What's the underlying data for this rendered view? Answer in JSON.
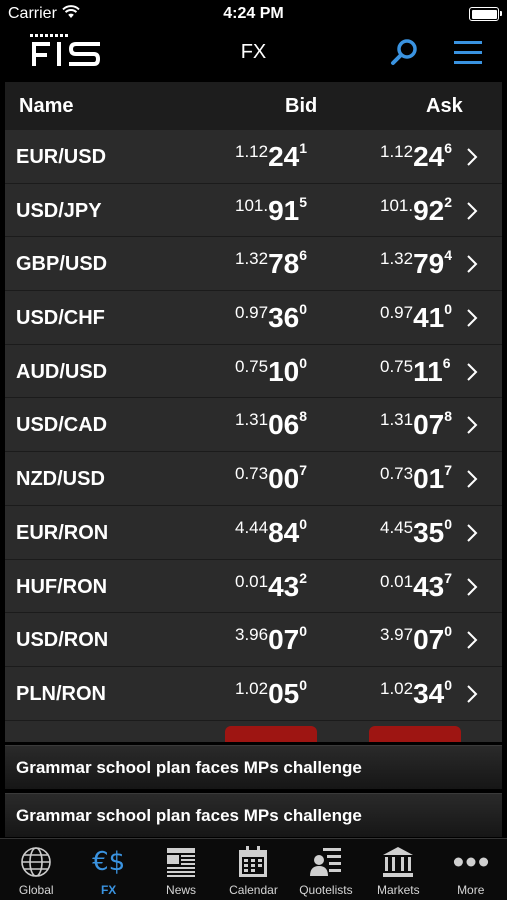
{
  "status": {
    "carrier": "Carrier",
    "time": "4:24 PM"
  },
  "nav": {
    "title": "FX"
  },
  "table": {
    "headers": {
      "name": "Name",
      "bid": "Bid",
      "ask": "Ask"
    },
    "rows": [
      {
        "name": "EUR/USD",
        "bid": [
          "1.12",
          "24",
          "1"
        ],
        "ask": [
          "1.12",
          "24",
          "6"
        ]
      },
      {
        "name": "USD/JPY",
        "bid": [
          "101.",
          "91",
          "5"
        ],
        "ask": [
          "101.",
          "92",
          "2"
        ]
      },
      {
        "name": "GBP/USD",
        "bid": [
          "1.32",
          "78",
          "6"
        ],
        "ask": [
          "1.32",
          "79",
          "4"
        ]
      },
      {
        "name": "USD/CHF",
        "bid": [
          "0.97",
          "36",
          "0"
        ],
        "ask": [
          "0.97",
          "41",
          "0"
        ]
      },
      {
        "name": "AUD/USD",
        "bid": [
          "0.75",
          "10",
          "0"
        ],
        "ask": [
          "0.75",
          "11",
          "6"
        ]
      },
      {
        "name": "USD/CAD",
        "bid": [
          "1.31",
          "06",
          "8"
        ],
        "ask": [
          "1.31",
          "07",
          "8"
        ]
      },
      {
        "name": "NZD/USD",
        "bid": [
          "0.73",
          "00",
          "7"
        ],
        "ask": [
          "0.73",
          "01",
          "7"
        ]
      },
      {
        "name": "EUR/RON",
        "bid": [
          "4.44",
          "84",
          "0"
        ],
        "ask": [
          "4.45",
          "35",
          "0"
        ]
      },
      {
        "name": "HUF/RON",
        "bid": [
          "0.01",
          "43",
          "2"
        ],
        "ask": [
          "0.01",
          "43",
          "7"
        ]
      },
      {
        "name": "USD/RON",
        "bid": [
          "3.96",
          "07",
          "0"
        ],
        "ask": [
          "3.97",
          "07",
          "0"
        ]
      },
      {
        "name": "PLN/RON",
        "bid": [
          "1.02",
          "05",
          "0"
        ],
        "ask": [
          "1.02",
          "34",
          "0"
        ]
      }
    ]
  },
  "news": [
    {
      "headline": "Grammar school plan faces MPs challenge"
    },
    {
      "headline": "Grammar school plan faces MPs challenge"
    }
  ],
  "tabs": [
    {
      "key": "global",
      "label": "Global",
      "icon": "globe-icon"
    },
    {
      "key": "fx",
      "label": "FX",
      "icon": "currency-exchange-icon",
      "active": true
    },
    {
      "key": "news",
      "label": "News",
      "icon": "newspaper-icon"
    },
    {
      "key": "calendar",
      "label": "Calendar",
      "icon": "calendar-icon"
    },
    {
      "key": "quotelists",
      "label": "Quotelists",
      "icon": "quotelist-icon"
    },
    {
      "key": "markets",
      "label": "Markets",
      "icon": "bank-building-icon"
    },
    {
      "key": "more",
      "label": "More",
      "icon": "more-dots-icon"
    }
  ],
  "colors": {
    "accent": "#3a93e0",
    "alert": "#9e1512",
    "row_bg": "#2b2b2b",
    "header_bg": "#1d1d1d"
  }
}
